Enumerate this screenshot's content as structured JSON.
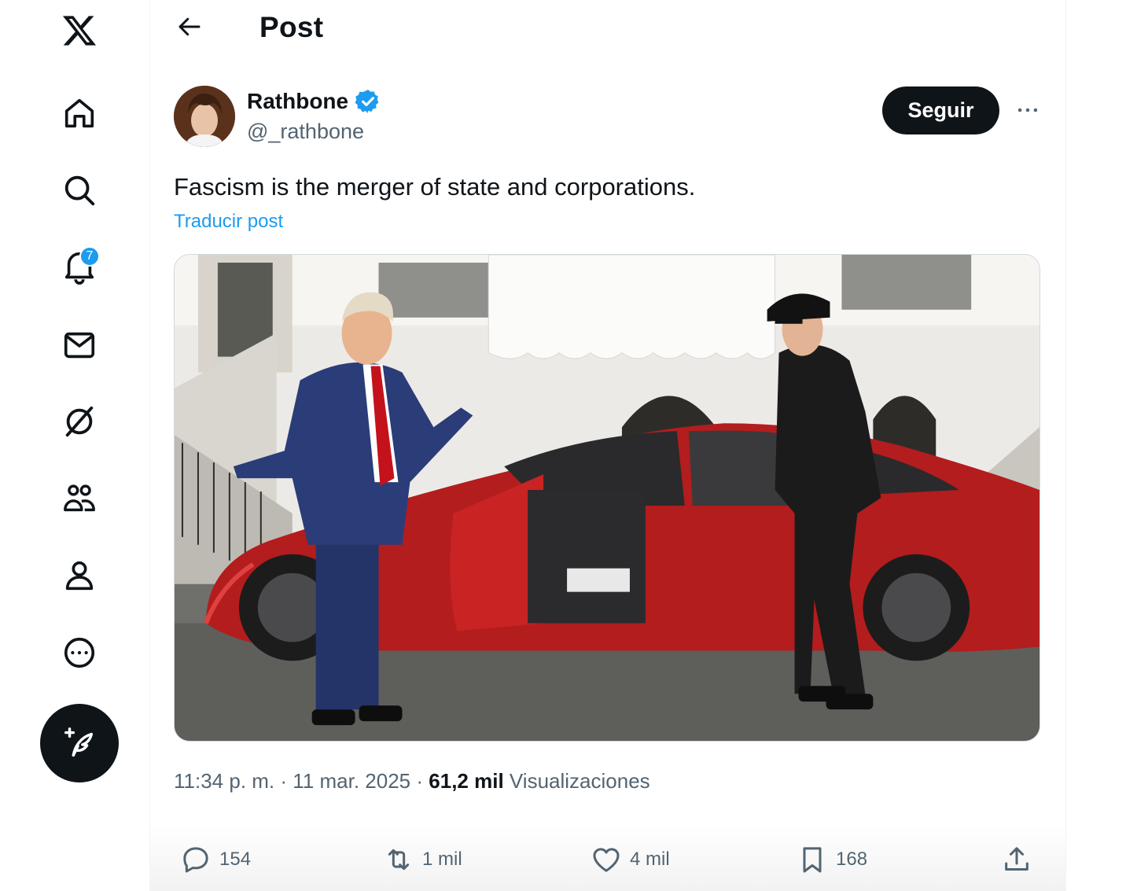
{
  "nav": {
    "items": [
      {
        "icon": "x-logo-icon"
      },
      {
        "icon": "home-icon"
      },
      {
        "icon": "search-icon"
      },
      {
        "icon": "bell-icon",
        "badge": "7"
      },
      {
        "icon": "mail-icon"
      },
      {
        "icon": "grok-icon"
      },
      {
        "icon": "communities-icon"
      },
      {
        "icon": "profile-icon"
      },
      {
        "icon": "more-circle-icon"
      }
    ],
    "compose_icon": "feather-plus-icon"
  },
  "header": {
    "title": "Post"
  },
  "post": {
    "author_name": "Rathbone",
    "handle": "@_rathbone",
    "follow_label": "Seguir",
    "text": "Fascism is the merger of state and corporations.",
    "translate_label": "Traducir post",
    "time": "11:34 p. m.",
    "date": "11 mar. 2025",
    "views_count": "61,2 mil",
    "views_label": "Visualizaciones",
    "separator": "·"
  },
  "actions": {
    "replies": "154",
    "reposts": "1 mil",
    "likes": "4 mil",
    "bookmarks": "168"
  },
  "colors": {
    "accent": "#1d9bf0",
    "text_primary": "#0f1419",
    "text_secondary": "#536471"
  }
}
